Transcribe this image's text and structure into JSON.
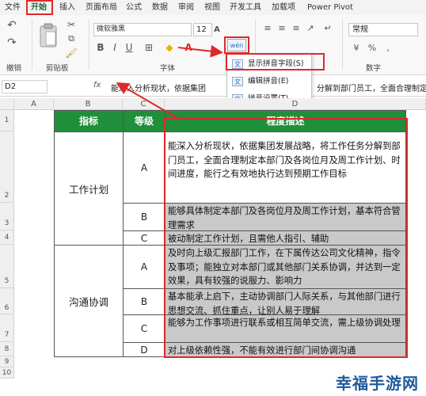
{
  "menubar": {
    "tabs": [
      "文件",
      "开始",
      "插入",
      "页面布局",
      "公式",
      "数据",
      "审阅",
      "视图",
      "开发工具",
      "加载项",
      "Power Pivot"
    ],
    "active_tab": "开始"
  },
  "ribbon": {
    "font_name": "微软雅黑",
    "font_size": "12",
    "groups": {
      "undo": "撤销",
      "clipboard": "剪贴板",
      "font": "字体",
      "number": "数字"
    },
    "number_format": "常规",
    "phonetic_button_label": "wén",
    "phonetic_menu": {
      "items": [
        {
          "icon_text": "文",
          "label": "显示拼音字段(S)"
        },
        {
          "icon_text": "文",
          "label": "编辑拼音(E)"
        },
        {
          "icon_text": "文",
          "label": "拼音设置(T)..."
        }
      ]
    }
  },
  "formula_bar": {
    "name_box": "D2",
    "fx": "fx",
    "formula": "能深入分析现状，依据集团",
    "formula_tail": "分解到部门员工，全面合理制定"
  },
  "sheet": {
    "columns": [
      "A",
      "B",
      "C",
      "D"
    ],
    "rows": [
      "1",
      "2",
      "3",
      "4",
      "5",
      "6",
      "7",
      "8",
      "9",
      "10"
    ],
    "header": {
      "indicator": "指标",
      "grade": "等级",
      "description": "程度描述"
    },
    "groups": [
      {
        "indicator": "工作计划",
        "entries": [
          {
            "grade": "A",
            "desc": "能深入分析现状，依据集团发展战略，将工作任务分解到部门员工，全面合理制定本部门及各岗位月及周工作计划、时间进度，能行之有效地执行达到预期工作目标"
          },
          {
            "grade": "B",
            "desc": "能够具体制定本部门及各岗位月及周工作计划，基本符合管理需求"
          },
          {
            "grade": "C",
            "desc": "被动制定工作计划，且需他人指引、辅助"
          }
        ]
      },
      {
        "indicator": "沟通协调",
        "entries": [
          {
            "grade": "A",
            "desc": "及时向上级汇报部门工作，在下属传达公司文化精神，指令及事项；能独立对本部门或其他部门关系协调，并达到一定效果，具有较强的说服力、影响力"
          },
          {
            "grade": "B",
            "desc": "基本能承上启下，主动协调部门人际关系，与其他部门进行思想交流、抓住重点，让别人易于理解"
          },
          {
            "grade": "C",
            "desc": "能够为工作事项进行联系或相互简单交流，需上级协调处理"
          },
          {
            "grade": "D",
            "desc": "对上级依赖性强，不能有效进行部门间协调沟通"
          }
        ]
      }
    ]
  },
  "watermark": "幸福手游网",
  "colors": {
    "header_green": "#1f8f3a",
    "highlight_red": "#e02828",
    "selected_gray": "#c9c9c9"
  }
}
